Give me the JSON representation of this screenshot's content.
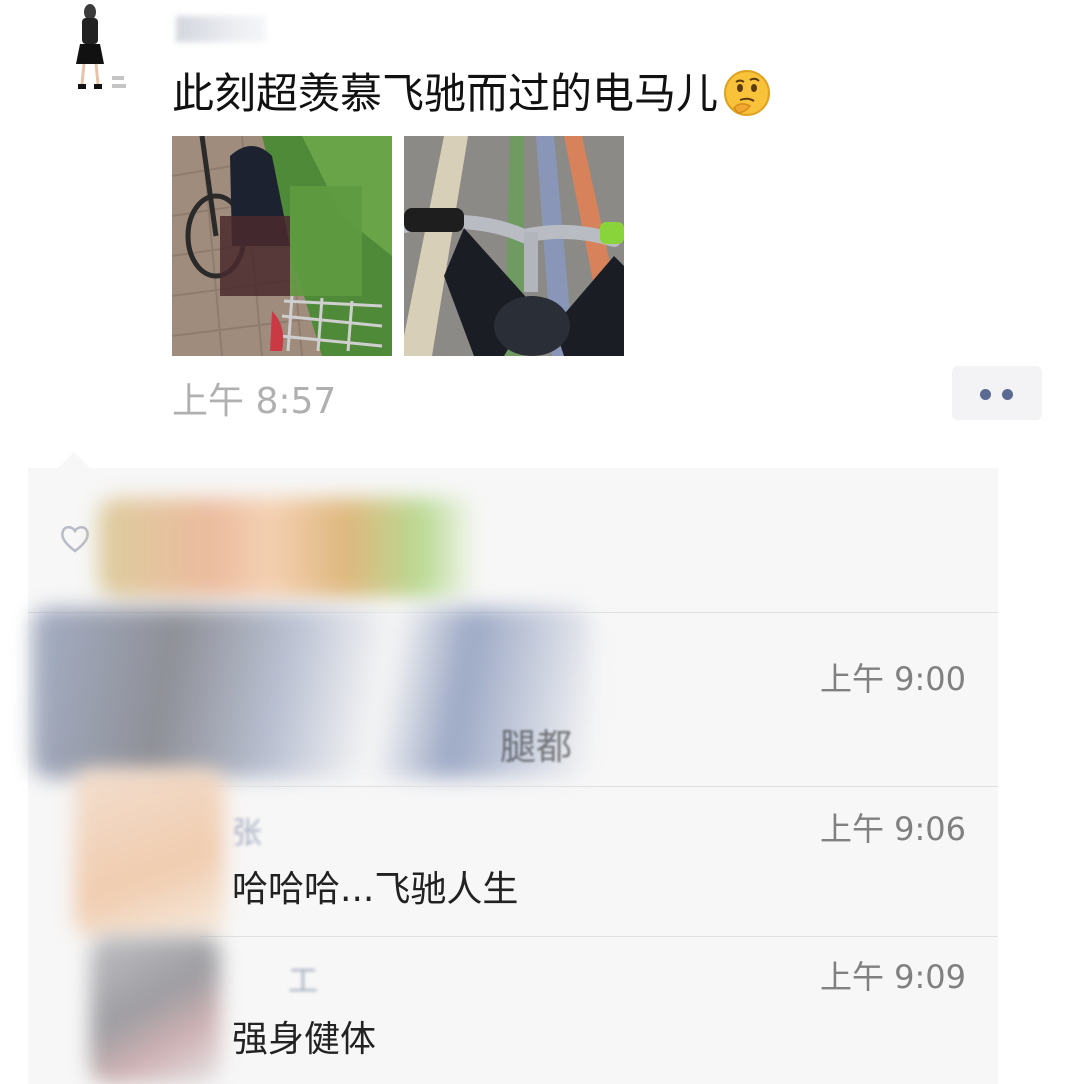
{
  "post": {
    "text": "此刻超羡慕飞驰而过的电马儿",
    "emoji": "thinking-face-emoji",
    "time": "上午 8:57"
  },
  "comments": [
    {
      "time": "上午 9:00",
      "text": "腿都",
      "name": ""
    },
    {
      "time": "上午 9:06",
      "text": "哈哈哈...飞驰人生",
      "name": "张"
    },
    {
      "time": "上午 9:09",
      "text": "强身健体",
      "name": "工"
    }
  ],
  "colors": {
    "accent": "#5b6a92",
    "panel": "#f7f7f7",
    "time": "#b0b0b0"
  }
}
